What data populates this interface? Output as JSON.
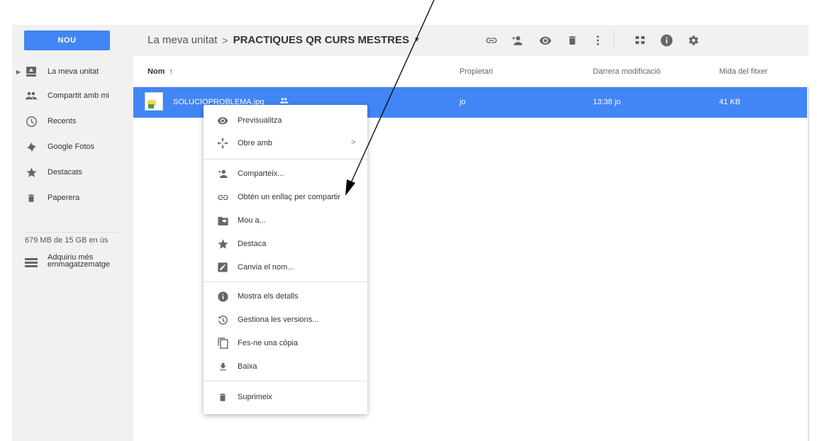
{
  "header": {
    "new_label": "NOU",
    "breadcrumb_root": "La meva unitat",
    "breadcrumb_sep": ">",
    "breadcrumb_current": "PRACTIQUES QR CURS MESTRES",
    "icons": [
      "link-icon",
      "add-person-icon",
      "preview-icon",
      "trash-icon",
      "more-vert-icon",
      "grid-view-icon",
      "info-icon",
      "settings-icon"
    ]
  },
  "sidebar": {
    "items": [
      {
        "label": "La meva unitat",
        "icon": "drive-icon"
      },
      {
        "label": "Compartit amb mi",
        "icon": "people-icon"
      },
      {
        "label": "Recents",
        "icon": "clock-icon"
      },
      {
        "label": "Google Fotos",
        "icon": "pinwheel-icon"
      },
      {
        "label": "Destacats",
        "icon": "star-icon"
      },
      {
        "label": "Paperera",
        "icon": "trash-icon"
      }
    ],
    "storage_text": "679 MB de 15 GB en ús",
    "buy_storage": "Adquiriu més emmagatzematge"
  },
  "list": {
    "columns": {
      "name": "Nom",
      "sort_arrow": "↑",
      "owner": "Propietari",
      "modified": "Darrera modificació",
      "size": "Mida del fitxer"
    },
    "files": [
      {
        "name": "SOLUCIOPROBLEMA.jpg",
        "owner": "jo",
        "modified": "13:38 jo",
        "size": "41 KB",
        "shared": true
      }
    ]
  },
  "context_menu": {
    "items": [
      {
        "label": "Previsualitza",
        "icon": "eye-icon"
      },
      {
        "label": "Obre amb",
        "icon": "open-with-icon",
        "submenu": ">"
      },
      {
        "label": "Comparteix...",
        "icon": "add-person-icon"
      },
      {
        "label": "Obtén un enllaç per compartir",
        "icon": "link-icon"
      },
      {
        "label": "Mou a...",
        "icon": "move-folder-icon"
      },
      {
        "label": "Destaca",
        "icon": "star-icon"
      },
      {
        "label": "Canvia el nom...",
        "icon": "edit-icon"
      },
      {
        "label": "Mostra els detalls",
        "icon": "info-icon"
      },
      {
        "label": "Gestiona les versions...",
        "icon": "history-icon"
      },
      {
        "label": "Fes-ne una còpia",
        "icon": "copy-icon"
      },
      {
        "label": "Baixa",
        "icon": "download-icon"
      },
      {
        "label": "Suprimeix",
        "icon": "trash-icon"
      }
    ]
  },
  "colors": {
    "accent": "#4285f4",
    "sidebar_bg": "#f1f1f1",
    "selected_row": "#4285f4"
  }
}
